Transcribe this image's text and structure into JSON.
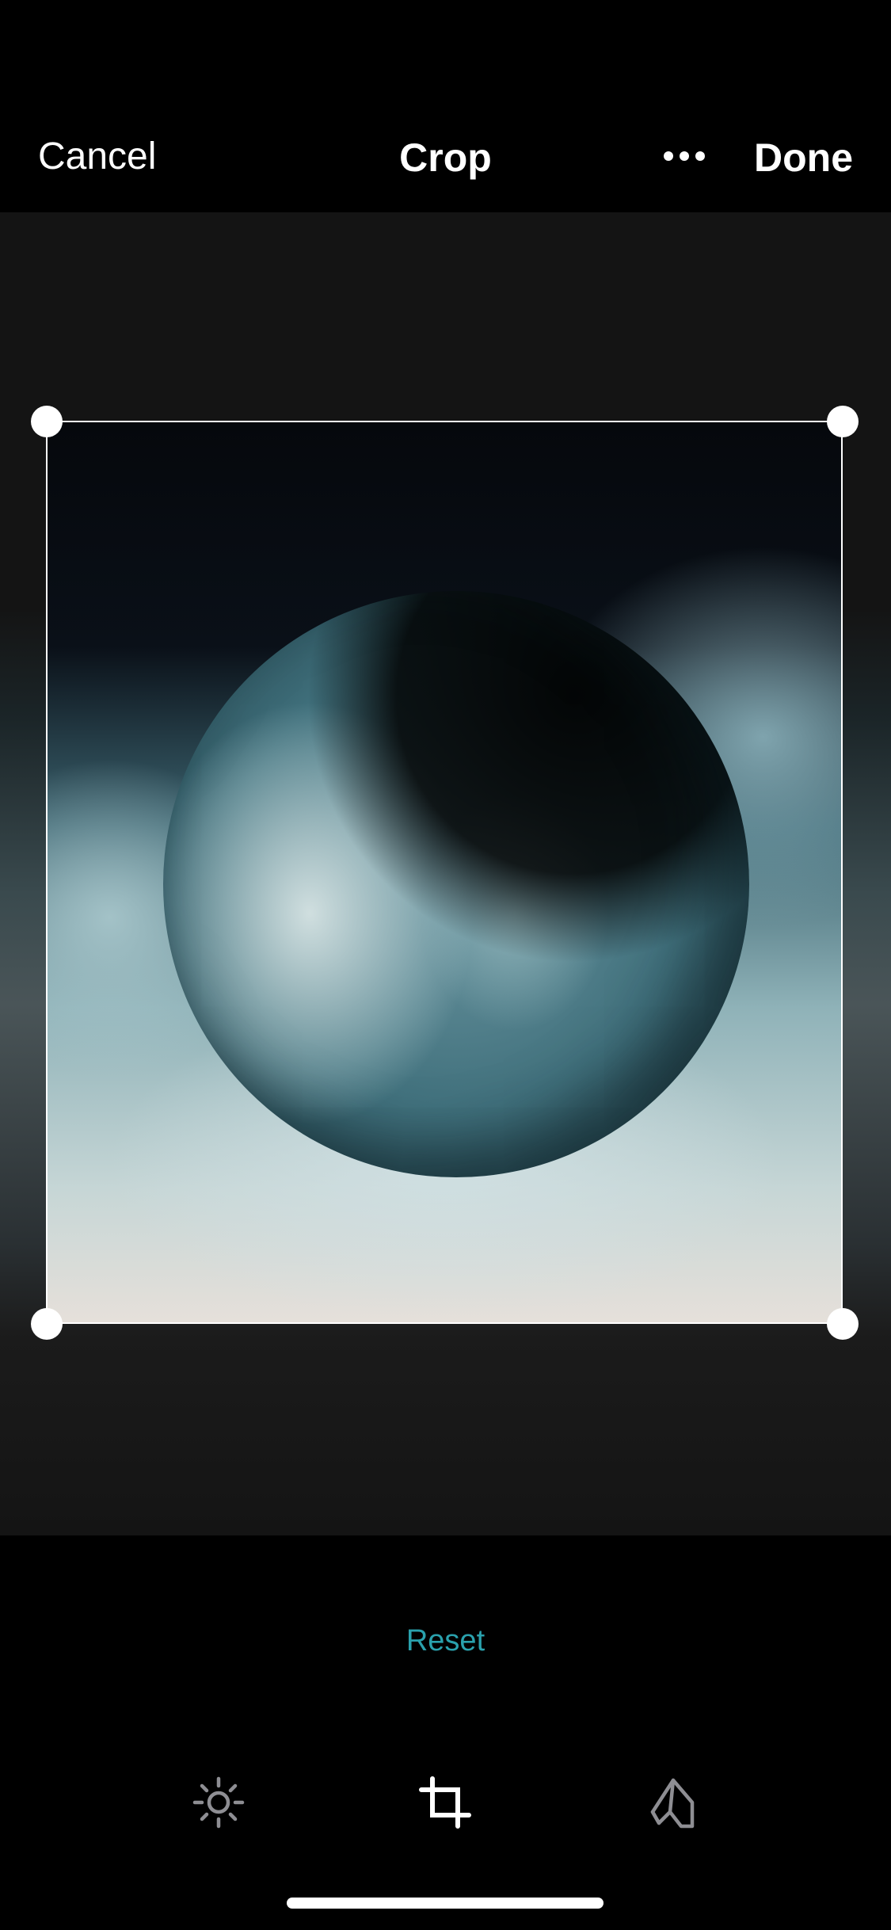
{
  "header": {
    "cancel_label": "Cancel",
    "title": "Crop",
    "done_label": "Done",
    "more_icon": "ellipsis-icon"
  },
  "editor": {
    "mode": "crop"
  },
  "footer": {
    "reset_label": "Reset",
    "reset_color": "#2aa1ad",
    "tools": [
      {
        "name": "adjust",
        "icon": "brightness-icon",
        "active": false
      },
      {
        "name": "crop",
        "icon": "crop-icon",
        "active": true
      },
      {
        "name": "markup",
        "icon": "markup-pen-icon",
        "active": false
      }
    ]
  },
  "colors": {
    "background": "#000000",
    "canvas": "#141414",
    "accent": "#2aa1ad",
    "frame": "#ffffff",
    "inactive_icon": "#8e8e93"
  }
}
